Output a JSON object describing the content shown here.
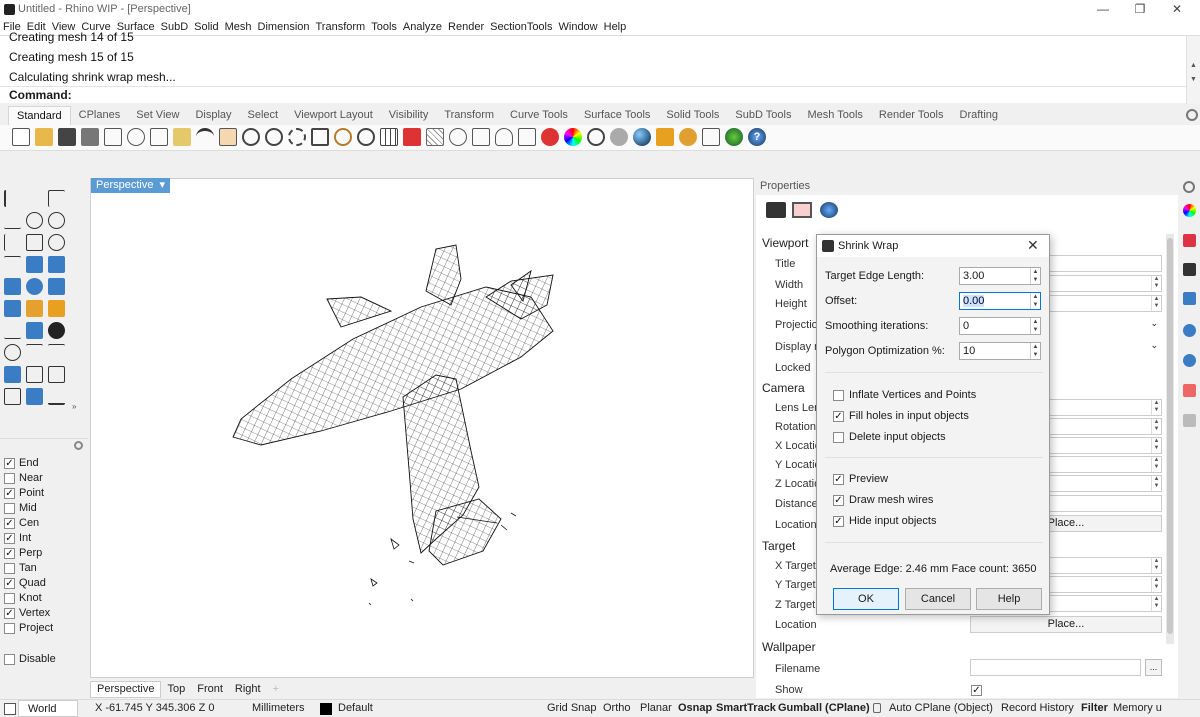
{
  "window": {
    "title": "Untitled - Rhino WIP - [Perspective]",
    "min": "—",
    "max": "❐",
    "close": "✕"
  },
  "menu": [
    "File",
    "Edit",
    "View",
    "Curve",
    "Surface",
    "SubD",
    "Solid",
    "Mesh",
    "Dimension",
    "Transform",
    "Tools",
    "Analyze",
    "Render",
    "SectionTools",
    "Window",
    "Help"
  ],
  "command": {
    "history": [
      "Creating mesh 14 of 15",
      "Creating mesh 15 of 15",
      "Calculating shrink wrap mesh..."
    ],
    "prompt": "Command:"
  },
  "toolbar_tabs": [
    "Standard",
    "CPlanes",
    "Set View",
    "Display",
    "Select",
    "Viewport Layout",
    "Visibility",
    "Transform",
    "Curve Tools",
    "Surface Tools",
    "Solid Tools",
    "SubD Tools",
    "Mesh Tools",
    "Render Tools",
    "Drafting"
  ],
  "osnap": [
    {
      "label": "End",
      "checked": true
    },
    {
      "label": "Near",
      "checked": false
    },
    {
      "label": "Point",
      "checked": true
    },
    {
      "label": "Mid",
      "checked": false
    },
    {
      "label": "Cen",
      "checked": true
    },
    {
      "label": "Int",
      "checked": true
    },
    {
      "label": "Perp",
      "checked": true
    },
    {
      "label": "Tan",
      "checked": false
    },
    {
      "label": "Quad",
      "checked": true
    },
    {
      "label": "Knot",
      "checked": false
    },
    {
      "label": "Vertex",
      "checked": true
    },
    {
      "label": "Project",
      "checked": false
    }
  ],
  "osnap_disable": {
    "label": "Disable",
    "checked": false
  },
  "viewport": {
    "active": "Perspective",
    "tabs": [
      "Perspective",
      "Top",
      "Front",
      "Right"
    ],
    "add": "+"
  },
  "properties": {
    "title": "Properties",
    "viewport_section": "Viewport",
    "viewport_rows": [
      "Title",
      "Width",
      "Height",
      "Projection",
      "Display m",
      "Locked"
    ],
    "camera_section": "Camera",
    "camera_rows": [
      "Lens Len",
      "Rotation",
      "X Locatio",
      "Y Locatio",
      "Z Locatio",
      "Distance",
      "Location"
    ],
    "target_section": "Target",
    "target_rows": [
      "X Target",
      "Y Target",
      "Z Target",
      "Location"
    ],
    "wallpaper_section": "Wallpaper",
    "wallpaper_rows": [
      "Filename",
      "Show"
    ],
    "place_button": "Place...",
    "browse_button": "...",
    "show_checked": "✓"
  },
  "dialog": {
    "title": "Shrink Wrap",
    "fields": [
      {
        "label": "Target Edge Length:",
        "value": "3.00"
      },
      {
        "label": "Offset:",
        "value": "0.00"
      },
      {
        "label": "Smoothing iterations:",
        "value": "0"
      },
      {
        "label": "Polygon Optimization %:",
        "value": "10"
      }
    ],
    "options": [
      {
        "label": "Inflate Vertices and Points",
        "checked": false
      },
      {
        "label": "Fill holes in input objects",
        "checked": true
      },
      {
        "label": "Delete input objects",
        "checked": false
      }
    ],
    "display": [
      {
        "label": "Preview",
        "checked": true
      },
      {
        "label": "Draw mesh wires",
        "checked": true
      },
      {
        "label": "Hide input objects",
        "checked": true
      }
    ],
    "info": "Average Edge: 2.46 mm Face count: 3650",
    "ok": "OK",
    "cancel": "Cancel",
    "help": "Help"
  },
  "status": {
    "cplane": "World",
    "coords": "X -61.745  Y 345.306  Z 0",
    "units": "Millimeters",
    "layer": "Default",
    "toggles": [
      {
        "label": "Grid Snap",
        "bold": false
      },
      {
        "label": "Ortho",
        "bold": false
      },
      {
        "label": "Planar",
        "bold": false
      },
      {
        "label": "Osnap",
        "bold": true
      },
      {
        "label": "SmartTrack",
        "bold": true
      },
      {
        "label": "Gumball (CPlane)",
        "bold": true
      },
      {
        "label": "Auto CPlane (Object)",
        "bold": false
      },
      {
        "label": "Record History",
        "bold": false
      },
      {
        "label": "Filter",
        "bold": true
      },
      {
        "label": "Memory u",
        "bold": false
      }
    ]
  }
}
